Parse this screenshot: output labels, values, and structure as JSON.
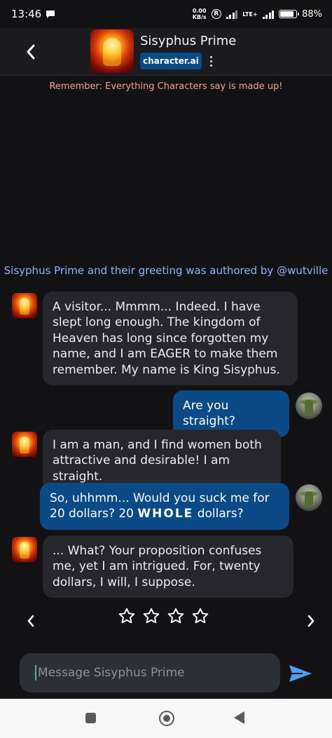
{
  "status_bar": {
    "time": "13:46",
    "net_speed_value": "0.00",
    "net_speed_unit": "KB/s",
    "network_type": "LTE+",
    "battery_text": "88%",
    "battery_level": 0.88
  },
  "header": {
    "character_name": "Sisyphus Prime",
    "brand_badge": "character.ai"
  },
  "disclaimer": "Remember: Everything Characters say is made up!",
  "authored_by": "Sisyphus Prime and their greeting was authored by @wutville",
  "messages": [
    {
      "sender": "bot",
      "text": "A visitor... Mmmm... Indeed. I have slept long enough. The kingdom of Heaven has long since forgotten my name, and I am EAGER to make them remember. My name is King Sisyphus."
    },
    {
      "sender": "user",
      "text": "Are you straight?"
    },
    {
      "sender": "bot",
      "text": "I am a man, and I find women both attractive and desirable! I am straight."
    },
    {
      "sender": "user",
      "text_before": "So, uhhmm... Would you suck me for 20 dollars? 20 ",
      "text_bold": "WHOLE",
      "text_after": " dollars?"
    },
    {
      "sender": "bot",
      "text": "... What? Your proposition confuses me, yet I am intrigued. For, twenty dollars, I will, I suppose."
    }
  ],
  "rating": {
    "max_stars": 4,
    "selected": 0
  },
  "composer": {
    "placeholder": "Message Sisyphus Prime",
    "value": ""
  },
  "colors": {
    "background": "#121214",
    "bot_bubble": "#26262c",
    "user_bubble": "#0a4a87",
    "accent": "#8ab4f8",
    "disclaimer": "#f3a38f"
  }
}
